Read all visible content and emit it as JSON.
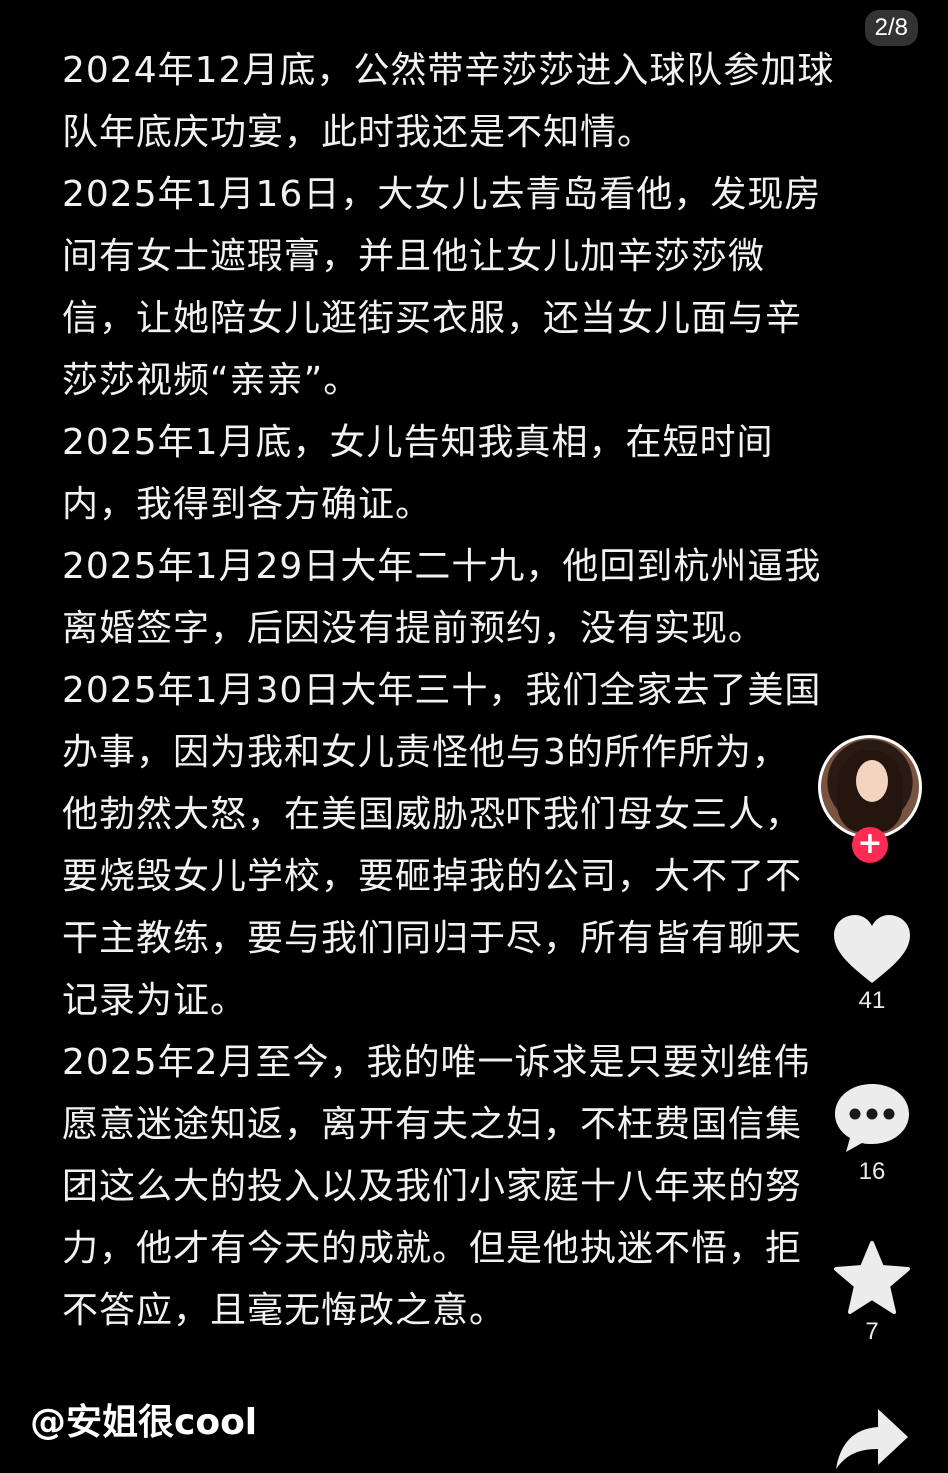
{
  "page_counter": "2/8",
  "lines": [
    "2024年12月底，公然带辛莎莎进入球队参加球",
    "队年底庆功宴，此时我还是不知情。",
    "2025年1月16日，大女儿去青岛看他，发现房",
    "间有女士遮瑕膏，并且他让女儿加辛莎莎微",
    "信，让她陪女儿逛街买衣服，还当女儿面与辛",
    "莎莎视频“亲亲”。",
    "2025年1月底，女儿告知我真相，在短时间",
    "内，我得到各方确证。",
    "2025年1月29日大年二十九，他回到杭州逼我",
    "离婚签字，后因没有提前预约，没有实现。",
    "2025年1月30日大年三十，我们全家去了美国",
    "办事，因为我和女儿责怪他与3的所作所为，",
    "他勃然大怒，在美国威胁恐吓我们母女三人，",
    "要烧毁女儿学校，要砸掉我的公司，大不了不",
    "干主教练，要与我们同归于尽，所有皆有聊天",
    "记录为证。",
    "2025年2月至今，我的唯一诉求是只要刘维伟",
    "愿意迷途知返，离开有夫之妇，不枉费国信集",
    "团这么大的投入以及我们小家庭十八年来的努",
    "力，他才有今天的成就。但是他执迷不悟，拒",
    "不答应，且毫无悔改之意。"
  ],
  "sidebar": {
    "follow_symbol": "+",
    "like_count": "41",
    "comment_count": "16",
    "favorite_count": "7",
    "icons": {
      "like": "heart-icon",
      "comment": "comment-icon",
      "favorite": "star-icon",
      "share": "share-icon"
    }
  },
  "watermark": "@安姐很cool",
  "colors": {
    "background": "#000000",
    "text": "#f2f2f2",
    "accent": "#fe2c55"
  }
}
